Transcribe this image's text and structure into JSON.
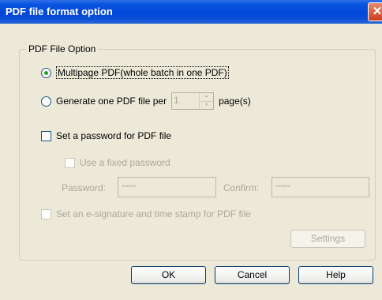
{
  "window": {
    "title": "PDF file format option",
    "close_glyph": "✕"
  },
  "group": {
    "legend": "PDF File Option"
  },
  "options": {
    "multipage_label": "Multipage PDF(whole batch in one PDF)",
    "multipage_selected": true,
    "per_file_label": "Generate one PDF file per",
    "pages_value": "1",
    "pages_unit": "page(s)",
    "set_password_label": "Set a password for PDF file",
    "fixed_password_label": "Use a fixed password",
    "password_label": "Password:",
    "password_value": "******",
    "confirm_label": "Confirm:",
    "confirm_value": "******",
    "esignature_label": "Set an e-signature and time stamp for PDF file",
    "settings_label": "Settings"
  },
  "buttons": {
    "ok": "OK",
    "cancel": "Cancel",
    "help": "Help"
  }
}
